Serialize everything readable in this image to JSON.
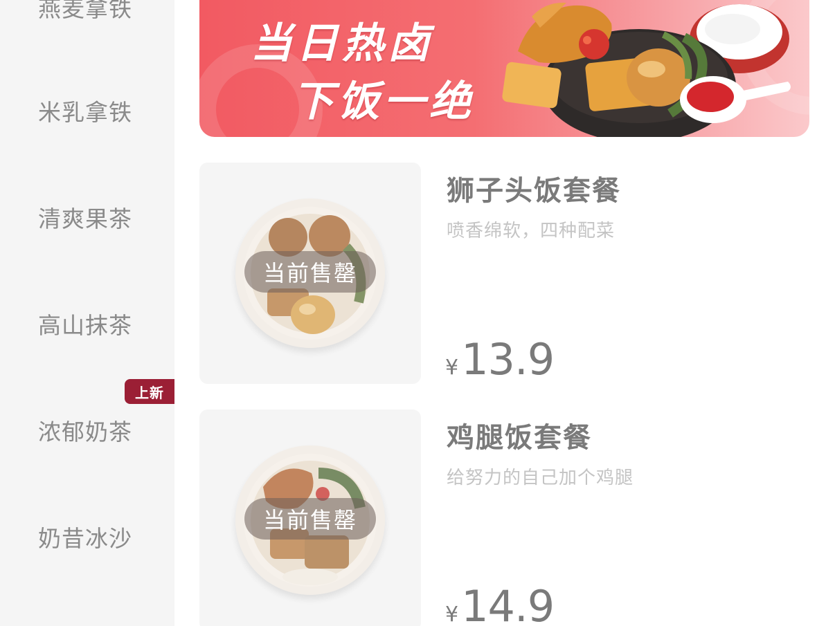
{
  "sidebar": {
    "items": [
      {
        "label": "燕麦拿铁"
      },
      {
        "label": "米乳拿铁"
      },
      {
        "label": "清爽果茶"
      },
      {
        "label": "高山抹茶"
      },
      {
        "label": "浓郁奶茶",
        "badge": "上新"
      },
      {
        "label": "奶昔冰沙"
      }
    ]
  },
  "banner": {
    "line1": "当日热卤",
    "line2": "下饭一绝"
  },
  "products": [
    {
      "name": "狮子头饭套餐",
      "desc": "喷香绵软，四种配菜",
      "currency": "¥",
      "price": "13.9",
      "status": "当前售罄"
    },
    {
      "name": "鸡腿饭套餐",
      "desc": "给努力的自己加个鸡腿",
      "currency": "¥",
      "price": "14.9",
      "status": "当前售罄"
    }
  ],
  "colors": {
    "accent": "#9b1f35",
    "banner": "#f25a62"
  }
}
